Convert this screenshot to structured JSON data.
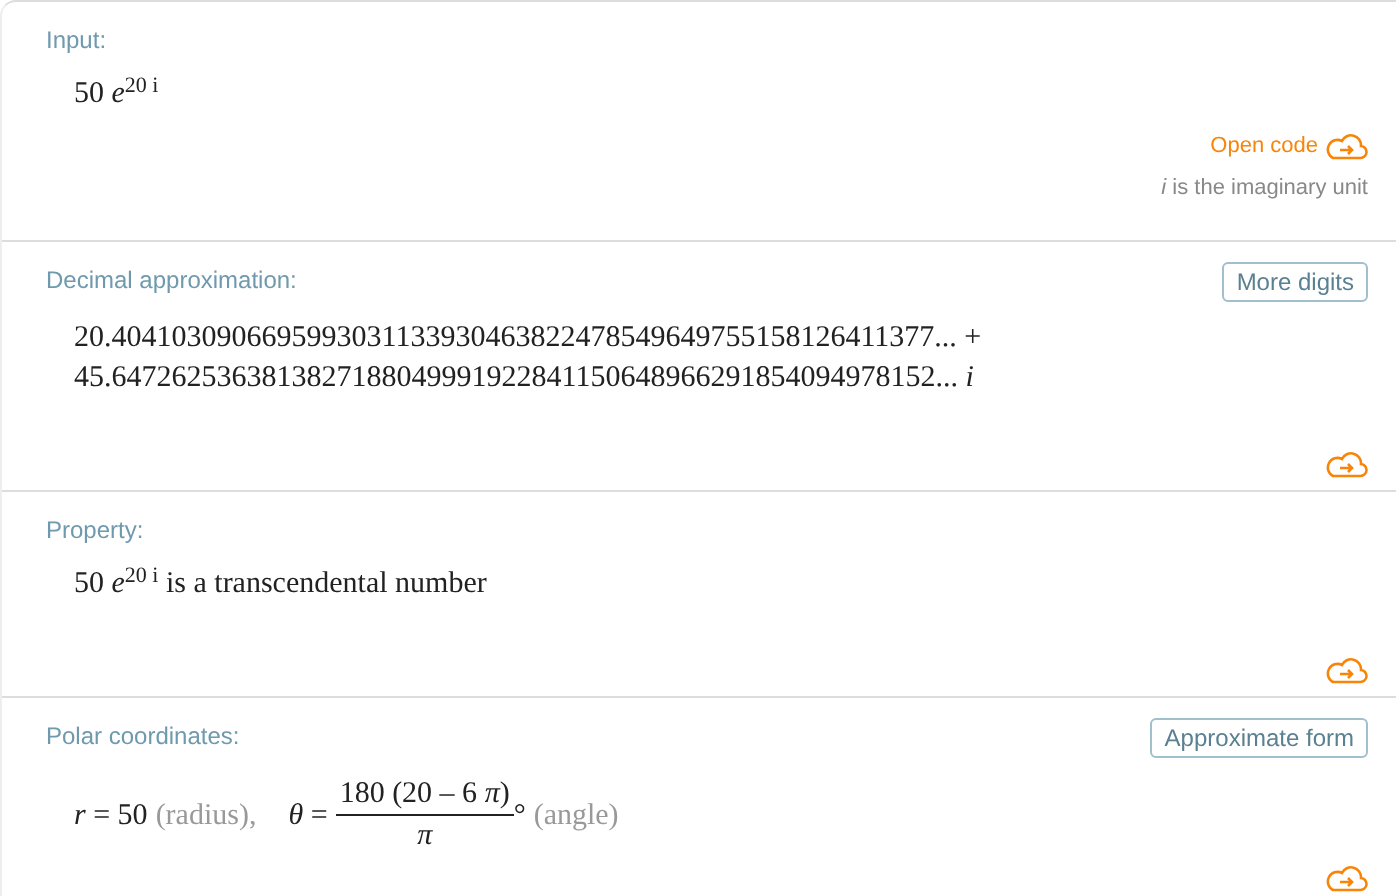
{
  "pods": [
    {
      "kind": "input",
      "title": "Input:",
      "expr": "50 *e*$^{20 i}$",
      "open_code": "Open code",
      "note": "*i* is the imaginary unit"
    },
    {
      "kind": "lines",
      "title": "Decimal approximation:",
      "button": "More digits",
      "lines": [
        "20.4041030906695993031133930463822478549649755158126411377... +",
        "45.6472625363813827188049991922841150648966291854094978152... *i*"
      ]
    },
    {
      "kind": "lines",
      "title": "Property:",
      "lines": [
        "50 *e*$^{20 i}$ is a transcendental number"
      ]
    },
    {
      "kind": "polar",
      "title": "Polar coordinates:",
      "button": "Approximate form",
      "r_expr": "*r* = 50",
      "r_note": "(radius),",
      "theta_expr": "*θ* =",
      "numerator": "180 (20 – 6 *π*)",
      "denominator": "*π*",
      "degree": "°",
      "theta_note": "(angle)"
    }
  ]
}
